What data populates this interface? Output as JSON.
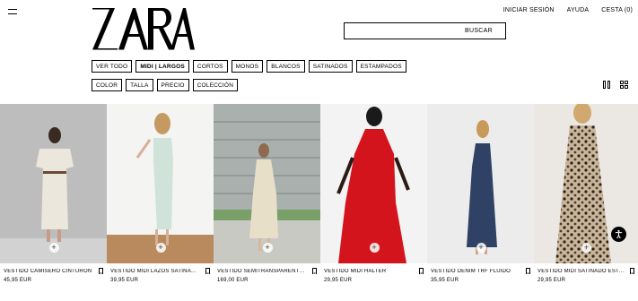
{
  "header": {
    "brand": "ZARA",
    "links": [
      "INICIAR SESIÓN",
      "AYUDA",
      "CESTA (0)"
    ],
    "search_label": "BUSCAR"
  },
  "filters": {
    "categories": [
      {
        "label": "VER TODO",
        "active": false
      },
      {
        "label": "MIDI | LARGOS",
        "active": true
      },
      {
        "label": "CORTOS",
        "active": false
      },
      {
        "label": "MONOS",
        "active": false
      },
      {
        "label": "BLANCOS",
        "active": false
      },
      {
        "label": "SATINADOS",
        "active": false
      },
      {
        "label": "ESTAMPADOS",
        "active": false
      }
    ],
    "attributes": [
      "COLOR",
      "TALLA",
      "PRECIO",
      "COLECCIÓN"
    ]
  },
  "view_icons": [
    "two-column-view-icon",
    "four-column-view-icon"
  ],
  "products": [
    {
      "name": "VESTIDO CAMISERO CINTURÓN",
      "price": "45,95 EUR",
      "dress_color": "#ece7dc",
      "bg": "#bdbdbd"
    },
    {
      "name": "VESTIDO MIDI LAZOS SATINADOS",
      "price": "39,95 EUR",
      "dress_color": "#cfe3d8",
      "bg": "#f4f4f2"
    },
    {
      "name": "VESTIDO SEMITRANSPARENTE ...",
      "price": "169,00 EUR",
      "dress_color": "#e8dfc8",
      "bg": "#8a8f8c"
    },
    {
      "name": "VESTIDO MIDI HALTER",
      "price": "29,95 EUR",
      "dress_color": "#d4141c",
      "bg": "#f3f3f3"
    },
    {
      "name": "VESTIDO DENIM TRF FLUIDO",
      "price": "35,95 EUR",
      "dress_color": "#2f4266",
      "bg": "#ececec"
    },
    {
      "name": "VESTIDO MIDI SATINADO ESTA...",
      "price": "29,95 EUR",
      "dress_color": "#8a7256",
      "bg": "#ebe8e4"
    }
  ]
}
